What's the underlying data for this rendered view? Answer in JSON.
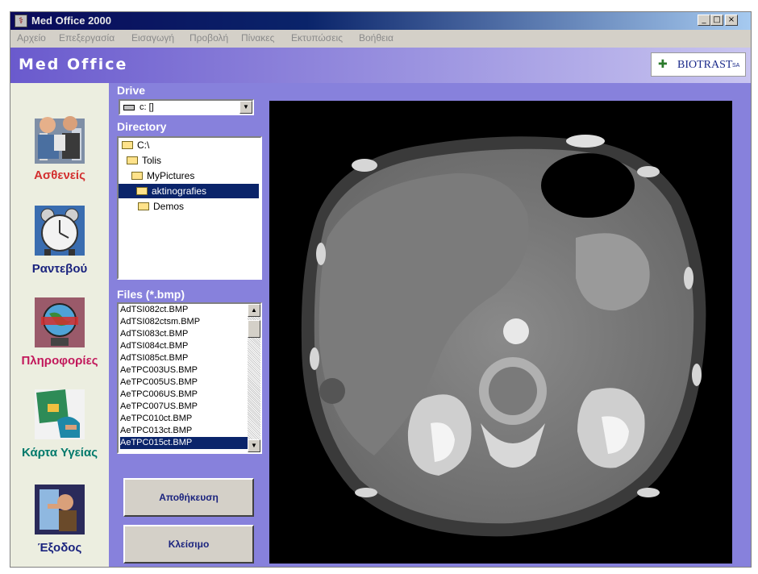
{
  "window": {
    "title": "Med Office 2000",
    "controls": {
      "minimize": "_",
      "maximize": "□",
      "close": "×"
    }
  },
  "menu": [
    "Αρχείο",
    "Επεξεργασία",
    "Εισαγωγή",
    "Προβολή",
    "Πίνακες",
    "Εκτυπώσεις",
    "Βοήθεια"
  ],
  "header": {
    "brand": "Med Office",
    "logo_text": "BIOTRAST",
    "logo_suffix": "SA"
  },
  "nav": [
    {
      "label": "Ασθενείς",
      "color": "#d32f2f",
      "icon": "patients-icon"
    },
    {
      "label": "Ραντεβού",
      "color": "#1a237e",
      "icon": "alarm-clock-icon"
    },
    {
      "label": "Πληροφορίες",
      "color": "#c2185b",
      "icon": "globe-icon"
    },
    {
      "label": "Κάρτα Υγείας",
      "color": "#00796b",
      "icon": "health-card-icon"
    },
    {
      "label": "Έξοδος",
      "color": "#1a237e",
      "icon": "exit-icon"
    }
  ],
  "drive": {
    "label": "Drive",
    "value": "c: []"
  },
  "directory": {
    "label": "Directory",
    "items": [
      {
        "name": "C:\\",
        "indent": 0
      },
      {
        "name": "Tolis",
        "indent": 1
      },
      {
        "name": "MyPictures",
        "indent": 2
      },
      {
        "name": "aktinografies",
        "indent": 3,
        "selected": true
      },
      {
        "name": "Demos",
        "indent": 4
      }
    ]
  },
  "files": {
    "label": "Files (*.bmp)",
    "items": [
      "AdTSI082ct.BMP",
      "AdTSI082ctsm.BMP",
      "AdTSI083ct.BMP",
      "AdTSI084ct.BMP",
      "AdTSI085ct.BMP",
      "AeTPC003US.BMP",
      "AeTPC005US.BMP",
      "AeTPC006US.BMP",
      "AeTPC007US.BMP",
      "AeTPC010ct.BMP",
      "AeTPC013ct.BMP",
      "AeTPC015ct.BMP"
    ],
    "selected_index": 11
  },
  "buttons": {
    "save": "Αποθήκευση",
    "close": "Κλείσιμο"
  },
  "colors": {
    "panel": "#8781dc",
    "selection": "#0a246a"
  }
}
